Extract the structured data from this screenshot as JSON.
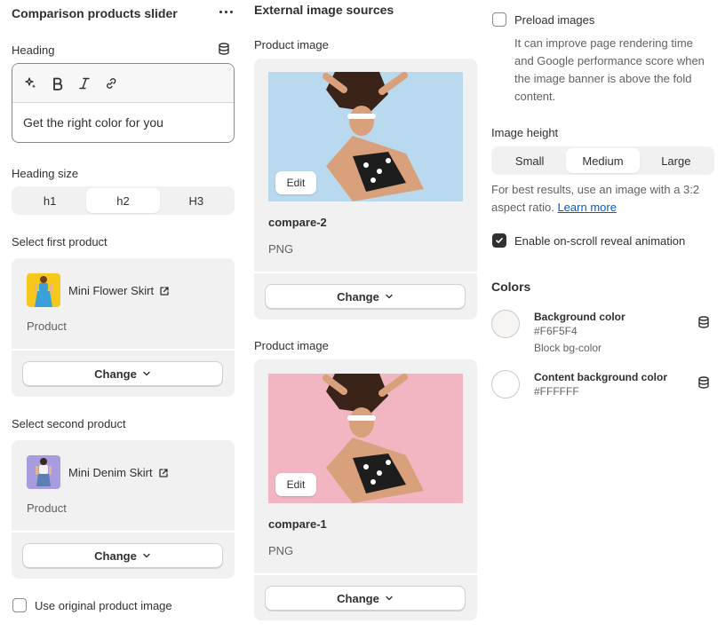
{
  "panel": {
    "title": "Comparison products slider",
    "more_icon": "more-horizontal-icon"
  },
  "heading": {
    "label": "Heading",
    "value": "Get the right color for you",
    "toolbar": [
      "magic-icon",
      "bold-icon",
      "italic-icon",
      "link-icon"
    ]
  },
  "heading_size": {
    "label": "Heading size",
    "options": [
      "h1",
      "h2",
      "H3"
    ],
    "selected": "h2"
  },
  "first_product": {
    "label": "Select first product",
    "name": "Mini Flower Skirt",
    "type": "Product",
    "change_label": "Change"
  },
  "second_product": {
    "label": "Select second product",
    "name": "Mini Denim Skirt",
    "type": "Product",
    "change_label": "Change"
  },
  "use_original": {
    "label": "Use original product image",
    "checked": false
  },
  "external": {
    "title": "External image sources",
    "images": [
      {
        "label": "Product image",
        "name": "compare-2",
        "type": "PNG",
        "edit_label": "Edit",
        "change_label": "Change",
        "bg": "#b9d9ef"
      },
      {
        "label": "Product image",
        "name": "compare-1",
        "type": "PNG",
        "edit_label": "Edit",
        "change_label": "Change",
        "bg": "#f2b6c2"
      }
    ]
  },
  "preload": {
    "label": "Preload images",
    "help": "It can improve page rendering time and Google performance score when the image banner is above the fold content.",
    "checked": false
  },
  "image_height": {
    "label": "Image height",
    "options": [
      "Small",
      "Medium",
      "Large"
    ],
    "selected": "Medium",
    "help_prefix": "For best results, use an image with a 3:2 aspect ratio.",
    "help_link": "Learn more"
  },
  "reveal": {
    "label": "Enable on-scroll reveal animation",
    "checked": true
  },
  "colors": {
    "title": "Colors",
    "items": [
      {
        "name": "Background color",
        "hex": "#F6F5F4",
        "meta": "Block bg-color",
        "swatch": "#F6F5F4"
      },
      {
        "name": "Content background color",
        "hex": "#FFFFFF",
        "meta": "",
        "swatch": "#FFFFFF"
      }
    ]
  }
}
